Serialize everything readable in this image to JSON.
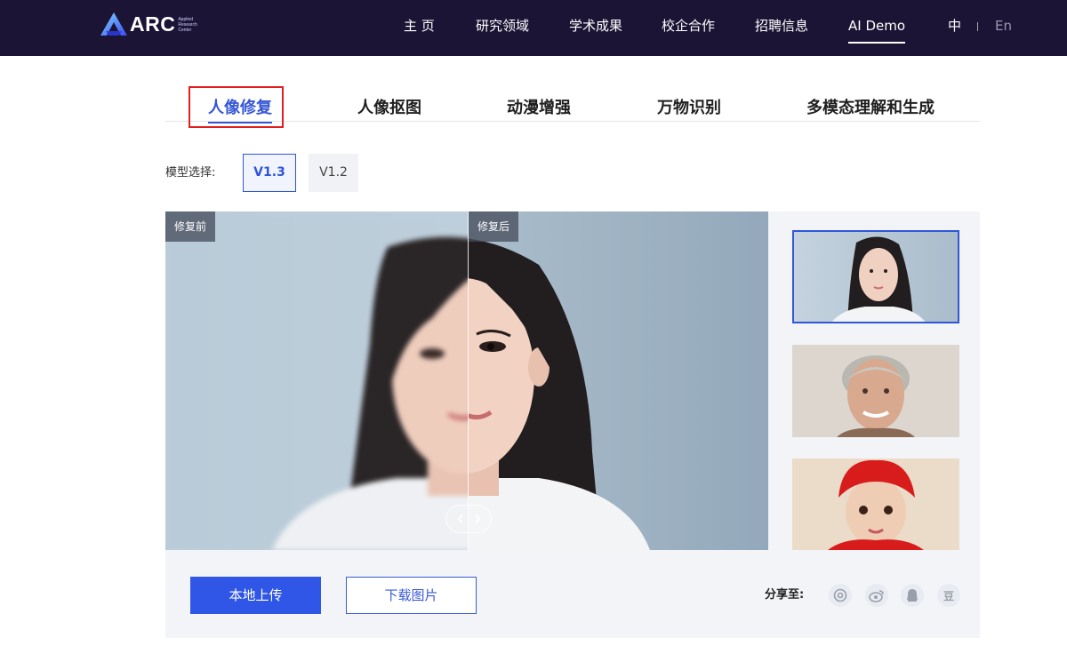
{
  "header": {
    "logo_text": "ARC",
    "logo_sub": [
      "Applied",
      "Research",
      "Center"
    ],
    "nav": [
      "主 页",
      "研究领域",
      "学术成果",
      "校企合作",
      "招聘信息",
      "AI Demo"
    ],
    "active_nav": "AI Demo",
    "lang_zh": "中",
    "lang_en": "En"
  },
  "tabs": [
    "人像修复",
    "人像抠图",
    "动漫增强",
    "万物识别",
    "多模态理解和生成"
  ],
  "active_tab": "人像修复",
  "model": {
    "label": "模型选择:",
    "versions": [
      "V1.3",
      "V1.2"
    ],
    "selected": "V1.3"
  },
  "viewer": {
    "before_label": "修复前",
    "after_label": "修复后"
  },
  "thumbnails": [
    "young-woman-portrait",
    "elderly-man-portrait",
    "child-red-hat-portrait"
  ],
  "actions": {
    "upload": "本地上传",
    "download": "下载图片"
  },
  "share": {
    "label": "分享至:",
    "channels": [
      "wechat-moments-icon",
      "weibo-icon",
      "qq-icon",
      "douban-icon"
    ],
    "douban_glyph": "豆"
  },
  "colors": {
    "nav_bg": "#1c1435",
    "accent": "#2f56e6",
    "active_tab": "#3656d6",
    "highlight_box": "#e02020"
  }
}
